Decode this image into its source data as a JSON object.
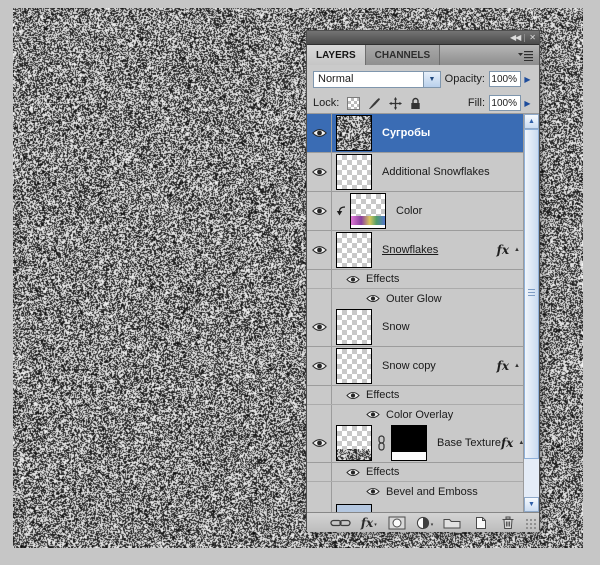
{
  "panel": {
    "titlebar_icons": {
      "collapse": "◀◀",
      "close": "✕"
    },
    "tabs": {
      "layers": "LAYERS",
      "channels": "CHANNELS"
    },
    "controls": {
      "blend_mode": "Normal",
      "opacity_label": "Opacity:",
      "opacity_value": "100%",
      "lock_label": "Lock:",
      "fill_label": "Fill:",
      "fill_value": "100%"
    },
    "effects_label": "Effects",
    "layers": [
      {
        "name": "Сугробы",
        "selected": true,
        "thumb": "noise"
      },
      {
        "name": "Additional Snowflakes",
        "thumb": "transparent-checker"
      },
      {
        "name": "Color",
        "thumb": "checker-with-color-band",
        "clipping_mask": true
      },
      {
        "name": "Snowflakes",
        "thumb": "transparent-checker",
        "has_fx": true,
        "effects": [
          "Outer Glow"
        ]
      },
      {
        "name": "Snow",
        "thumb": "transparent-checker"
      },
      {
        "name": "Snow copy",
        "thumb": "transparent-checker",
        "has_fx": true,
        "effects": [
          "Color Overlay"
        ]
      },
      {
        "name": "Base Texture",
        "thumb": "checker-with-texture",
        "has_mask": true,
        "linked_mask": true,
        "has_fx": true,
        "effects": [
          "Bevel and Emboss"
        ]
      }
    ],
    "colors": {
      "selected_layer": "#3a6cb4",
      "panel_bg": "#cacaca",
      "accent_blue": "#2f5fa8"
    }
  },
  "icons": {
    "fx": "fx",
    "effects_toggle": "▲",
    "dropdown": "▼",
    "spinner": "▶",
    "scroll_up": "▲",
    "scroll_down": "▼"
  }
}
